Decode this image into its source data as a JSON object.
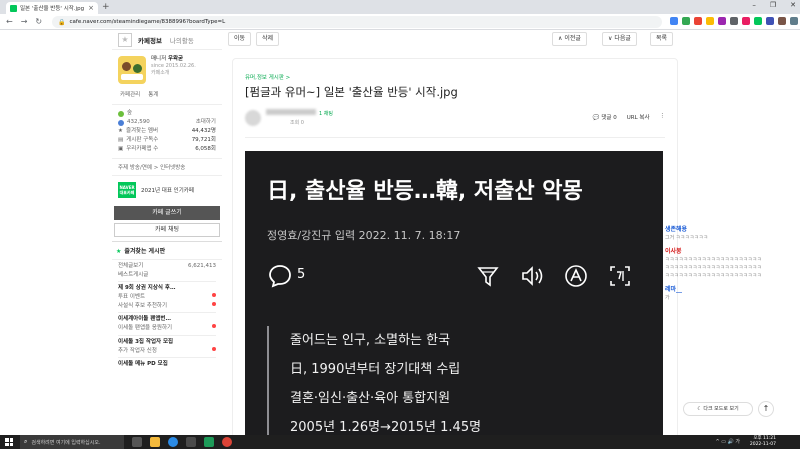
{
  "browser": {
    "tab_title": "일본 '출산율 반등' 시작.jpg : 네…",
    "tab_close": "×",
    "new_tab": "+",
    "url": "cafe.naver.com/steamindiegame/8388996?boardType=L",
    "window_buttons": [
      "–",
      "❐",
      "✕"
    ],
    "nav": [
      "←",
      "→",
      "↻"
    ]
  },
  "sidebar": {
    "tab_cafe_info": "카페정보",
    "tab_my_activity": "나의활동",
    "manager_label": "매니저",
    "manager_name": "우왁굳",
    "since": "since 2015.02.26.",
    "cafe_intro": "카페소개",
    "link_manage": "카페관리",
    "link_stats": "통계",
    "rank": "숲",
    "members_count": "432,590",
    "invite": "초대하기",
    "rows": [
      {
        "label": "즐겨찾는 멤버",
        "value": "44,432명"
      },
      {
        "label": "게시판 구독수",
        "value": "79,721회"
      },
      {
        "label": "우리카페앱 수",
        "value": "6,058회"
      }
    ],
    "theme": "주제 방송/연예 > 인터넷방송",
    "award_badge": "NAVER 대표카페",
    "award_text": "2021년 대표 인기카페",
    "write_button": "카페 글쓰기",
    "chat_button": "카페 채팅",
    "fav_boards_title": "즐겨찾는 게시판",
    "boards": [
      {
        "label": "전체글보기",
        "value": "6,621,413",
        "header": false,
        "new": false
      },
      {
        "label": "베스트게시글",
        "value": "",
        "header": false,
        "new": false
      },
      {
        "label": "제 9회 상권 지상식 후…",
        "value": "",
        "header": true,
        "new": false
      },
      {
        "label": "투표 이벤트",
        "value": "",
        "header": false,
        "new": true
      },
      {
        "label": "사설식 후보 추천하기",
        "value": "",
        "header": false,
        "new": true
      },
      {
        "label": "이세계아이돌 팬앱번…",
        "value": "",
        "header": true,
        "new": false
      },
      {
        "label": "이세돌 팬앱을 응원하기",
        "value": "",
        "header": false,
        "new": true
      },
      {
        "label": "이세돌 3집 작업자 모집",
        "value": "",
        "header": true,
        "new": false
      },
      {
        "label": "추가 작업자 신청",
        "value": "",
        "header": false,
        "new": true
      },
      {
        "label": "이세돌 메뉴 PD 모집",
        "value": "",
        "header": true,
        "new": false
      }
    ]
  },
  "toolbar": {
    "move": "이동",
    "delete": "삭제",
    "prev": "이전글",
    "next": "다음글",
    "list": "목록"
  },
  "post": {
    "breadcrumb": "유머,정보 게시판 >",
    "title": "[펌글과 유머~] 일본 '출산율 반등' 시작.jpg",
    "level": "1 채팅",
    "views": "조회 0",
    "comments": "댓글 0",
    "url_copy": "URL 복사"
  },
  "article": {
    "headline": "日, 출산율 반등…韓, 저출산 악몽",
    "byline": "정영효/강진규  입력 2022. 11. 7. 18:17",
    "comment_count": "5",
    "lines": [
      "줄어드는 인구, 소멸하는 한국",
      "日, 1990년부터 장기대책 수립",
      "결혼·임신·출산·육아 통합지원",
      "2005년 1.26명→2015년 1.45명"
    ]
  },
  "chat": [
    {
      "name": "생존해용",
      "body": "그거 ㅋㅋㅋㅋㅋㅋㅋ",
      "color": "#1a5bd6"
    },
    {
      "name": "이사봉",
      "body": "ㅋㅋㅋㅋㅋㅋㅋㅋㅋㅋㅋㅋㅋㅋㅋㅋㅋㅋㅋㅋㅋ",
      "color": "#d62020"
    },
    {
      "name": "레마__",
      "body": "가",
      "color": "#1a5bd6"
    }
  ],
  "darkmode": "다크 모드로 보기",
  "top_button": "↑",
  "taskbar": {
    "search_placeholder": "검색하려면 여기에 입력하십시오.",
    "time": "오후 11:21",
    "date": "2022-11-07"
  },
  "colors": {
    "naver_green": "#03c75a",
    "article_bg": "#1c1c1e"
  }
}
